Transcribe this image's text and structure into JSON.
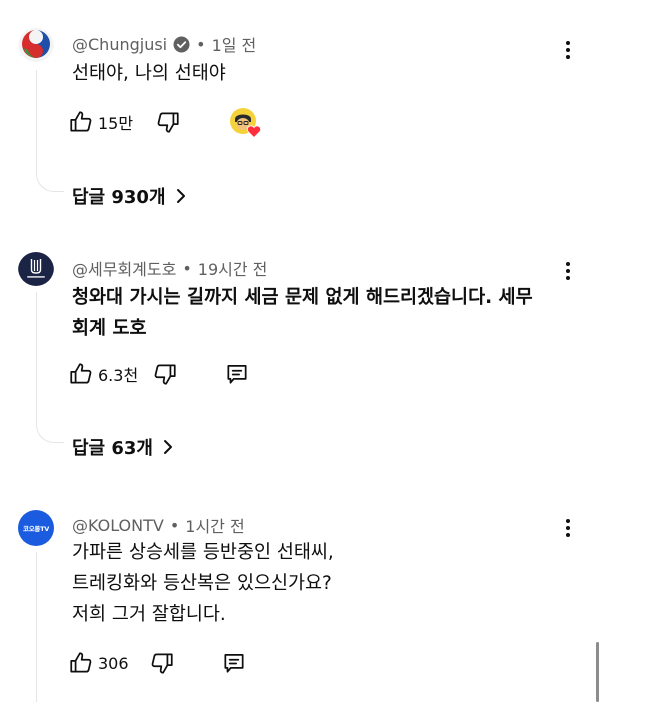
{
  "colors": {
    "text": "#0f0f0f",
    "meta": "#606060",
    "thread": "#e5e5e5",
    "kolon_blue": "#1a5be0"
  },
  "comments": [
    {
      "author": "@Chungjusi",
      "verified": true,
      "time": "1일 전",
      "body_lines": [
        "선태야, 나의 선태야"
      ],
      "like_count": "15만",
      "hearted_by_creator": true,
      "reply_label": "답글 930개",
      "avatar_icon": "korean-taegeuk-logo-icon"
    },
    {
      "author": "@세무회계도호",
      "verified": false,
      "time": "19시간 전",
      "body_lines": [
        "청와대 가시는 길까지 세금 문제 없게 해드리겠습니다. 세무",
        "회계 도호"
      ],
      "like_count": "6.3천",
      "hearted_by_creator": false,
      "reply_label": "답글 63개",
      "avatar_icon": "tax-office-logo-icon"
    },
    {
      "author": "@KOLONTV",
      "verified": false,
      "time": "1시간 전",
      "body_lines": [
        "가파른 상승세를 등반중인 선태씨,",
        "트레킹화와 등산복은 있으신가요?",
        "저희 그거 잘합니다."
      ],
      "like_count": "306",
      "hearted_by_creator": false,
      "avatar_text": "코오롱TV",
      "avatar_icon": "kolon-tv-logo-icon"
    }
  ]
}
